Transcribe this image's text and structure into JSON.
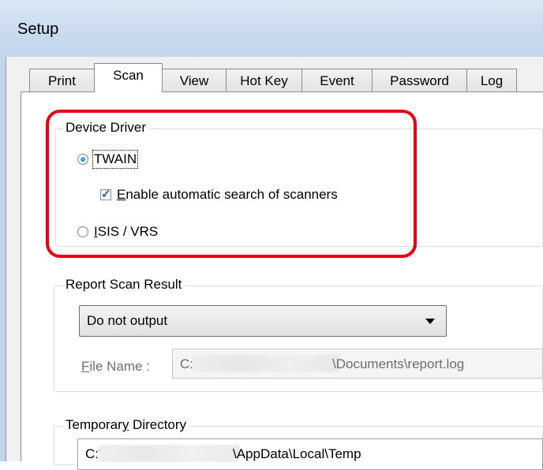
{
  "window": {
    "title": "Setup"
  },
  "tabs": [
    {
      "label": "Print",
      "active": false
    },
    {
      "label": "Scan",
      "active": true
    },
    {
      "label": "View",
      "active": false
    },
    {
      "label": "Hot Key",
      "active": false
    },
    {
      "label": "Event",
      "active": false
    },
    {
      "label": "Password",
      "active": false
    },
    {
      "label": "Log",
      "active": false
    }
  ],
  "device_driver": {
    "group_label": "Device Driver",
    "twain": {
      "label": "TWAIN",
      "selected": true
    },
    "auto_search": {
      "label_first": "E",
      "label_rest": "nable automatic search of scanners",
      "checked": true
    },
    "isis": {
      "label_first": "I",
      "label_rest": "SIS / VRS",
      "selected": false
    }
  },
  "report": {
    "group_label": "Report Scan Result",
    "output_value": "Do not output",
    "file_name_label_first": "F",
    "file_name_label_rest": "ile Name :",
    "file_prefix": "C:\\",
    "file_suffix": "\\Documents\\report.log"
  },
  "temp_dir": {
    "group_label_a": "Temporar",
    "group_label_u": "y",
    "group_label_b": " Directory",
    "path_prefix": "C:\\",
    "path_suffix": "\\AppData\\Local\\Temp"
  },
  "colors": {
    "highlight": "#e60012",
    "titlebar": "#c7d9ee"
  }
}
